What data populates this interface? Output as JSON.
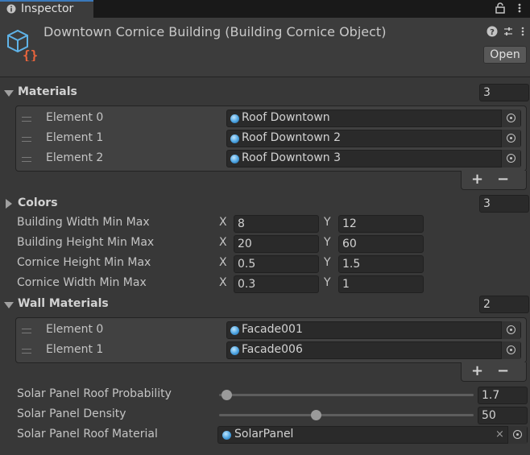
{
  "tab": {
    "label": "Inspector"
  },
  "header": {
    "title": "Downtown Cornice Building (Building Cornice Object)",
    "open_label": "Open"
  },
  "materials": {
    "label": "Materials",
    "count": "3",
    "items": [
      {
        "label": "Element 0",
        "value": "Roof Downtown"
      },
      {
        "label": "Element 1",
        "value": "Roof Downtown 2"
      },
      {
        "label": "Element 2",
        "value": "Roof Downtown 3"
      }
    ],
    "add": "+",
    "remove": "−"
  },
  "colors": {
    "label": "Colors",
    "count": "3"
  },
  "ranges": [
    {
      "label": "Building Width Min Max",
      "x_label": "X",
      "x": "8",
      "y_label": "Y",
      "y": "12"
    },
    {
      "label": "Building Height Min Max",
      "x_label": "X",
      "x": "20",
      "y_label": "Y",
      "y": "60"
    },
    {
      "label": "Cornice Height Min Max",
      "x_label": "X",
      "x": "0.5",
      "y_label": "Y",
      "y": "1.5"
    },
    {
      "label": "Cornice Width Min Max",
      "x_label": "X",
      "x": "0.3",
      "y_label": "Y",
      "y": "1"
    }
  ],
  "wall_materials": {
    "label": "Wall Materials",
    "count": "2",
    "items": [
      {
        "label": "Element 0",
        "value": "Facade001"
      },
      {
        "label": "Element 1",
        "value": "Facade006"
      }
    ],
    "add": "+",
    "remove": "−"
  },
  "solar": {
    "probability": {
      "label": "Solar Panel Roof Probability",
      "value": "1.7",
      "slider_fraction": 0.03
    },
    "density": {
      "label": "Solar Panel Density",
      "value": "50",
      "slider_fraction": 0.38
    },
    "material": {
      "label": "Solar Panel Roof Material",
      "value": "SolarPanel",
      "clear": "×"
    }
  },
  "colors_palette": {
    "accent": "#3a79bb",
    "background": "#383838",
    "field": "#2a2a2a"
  }
}
